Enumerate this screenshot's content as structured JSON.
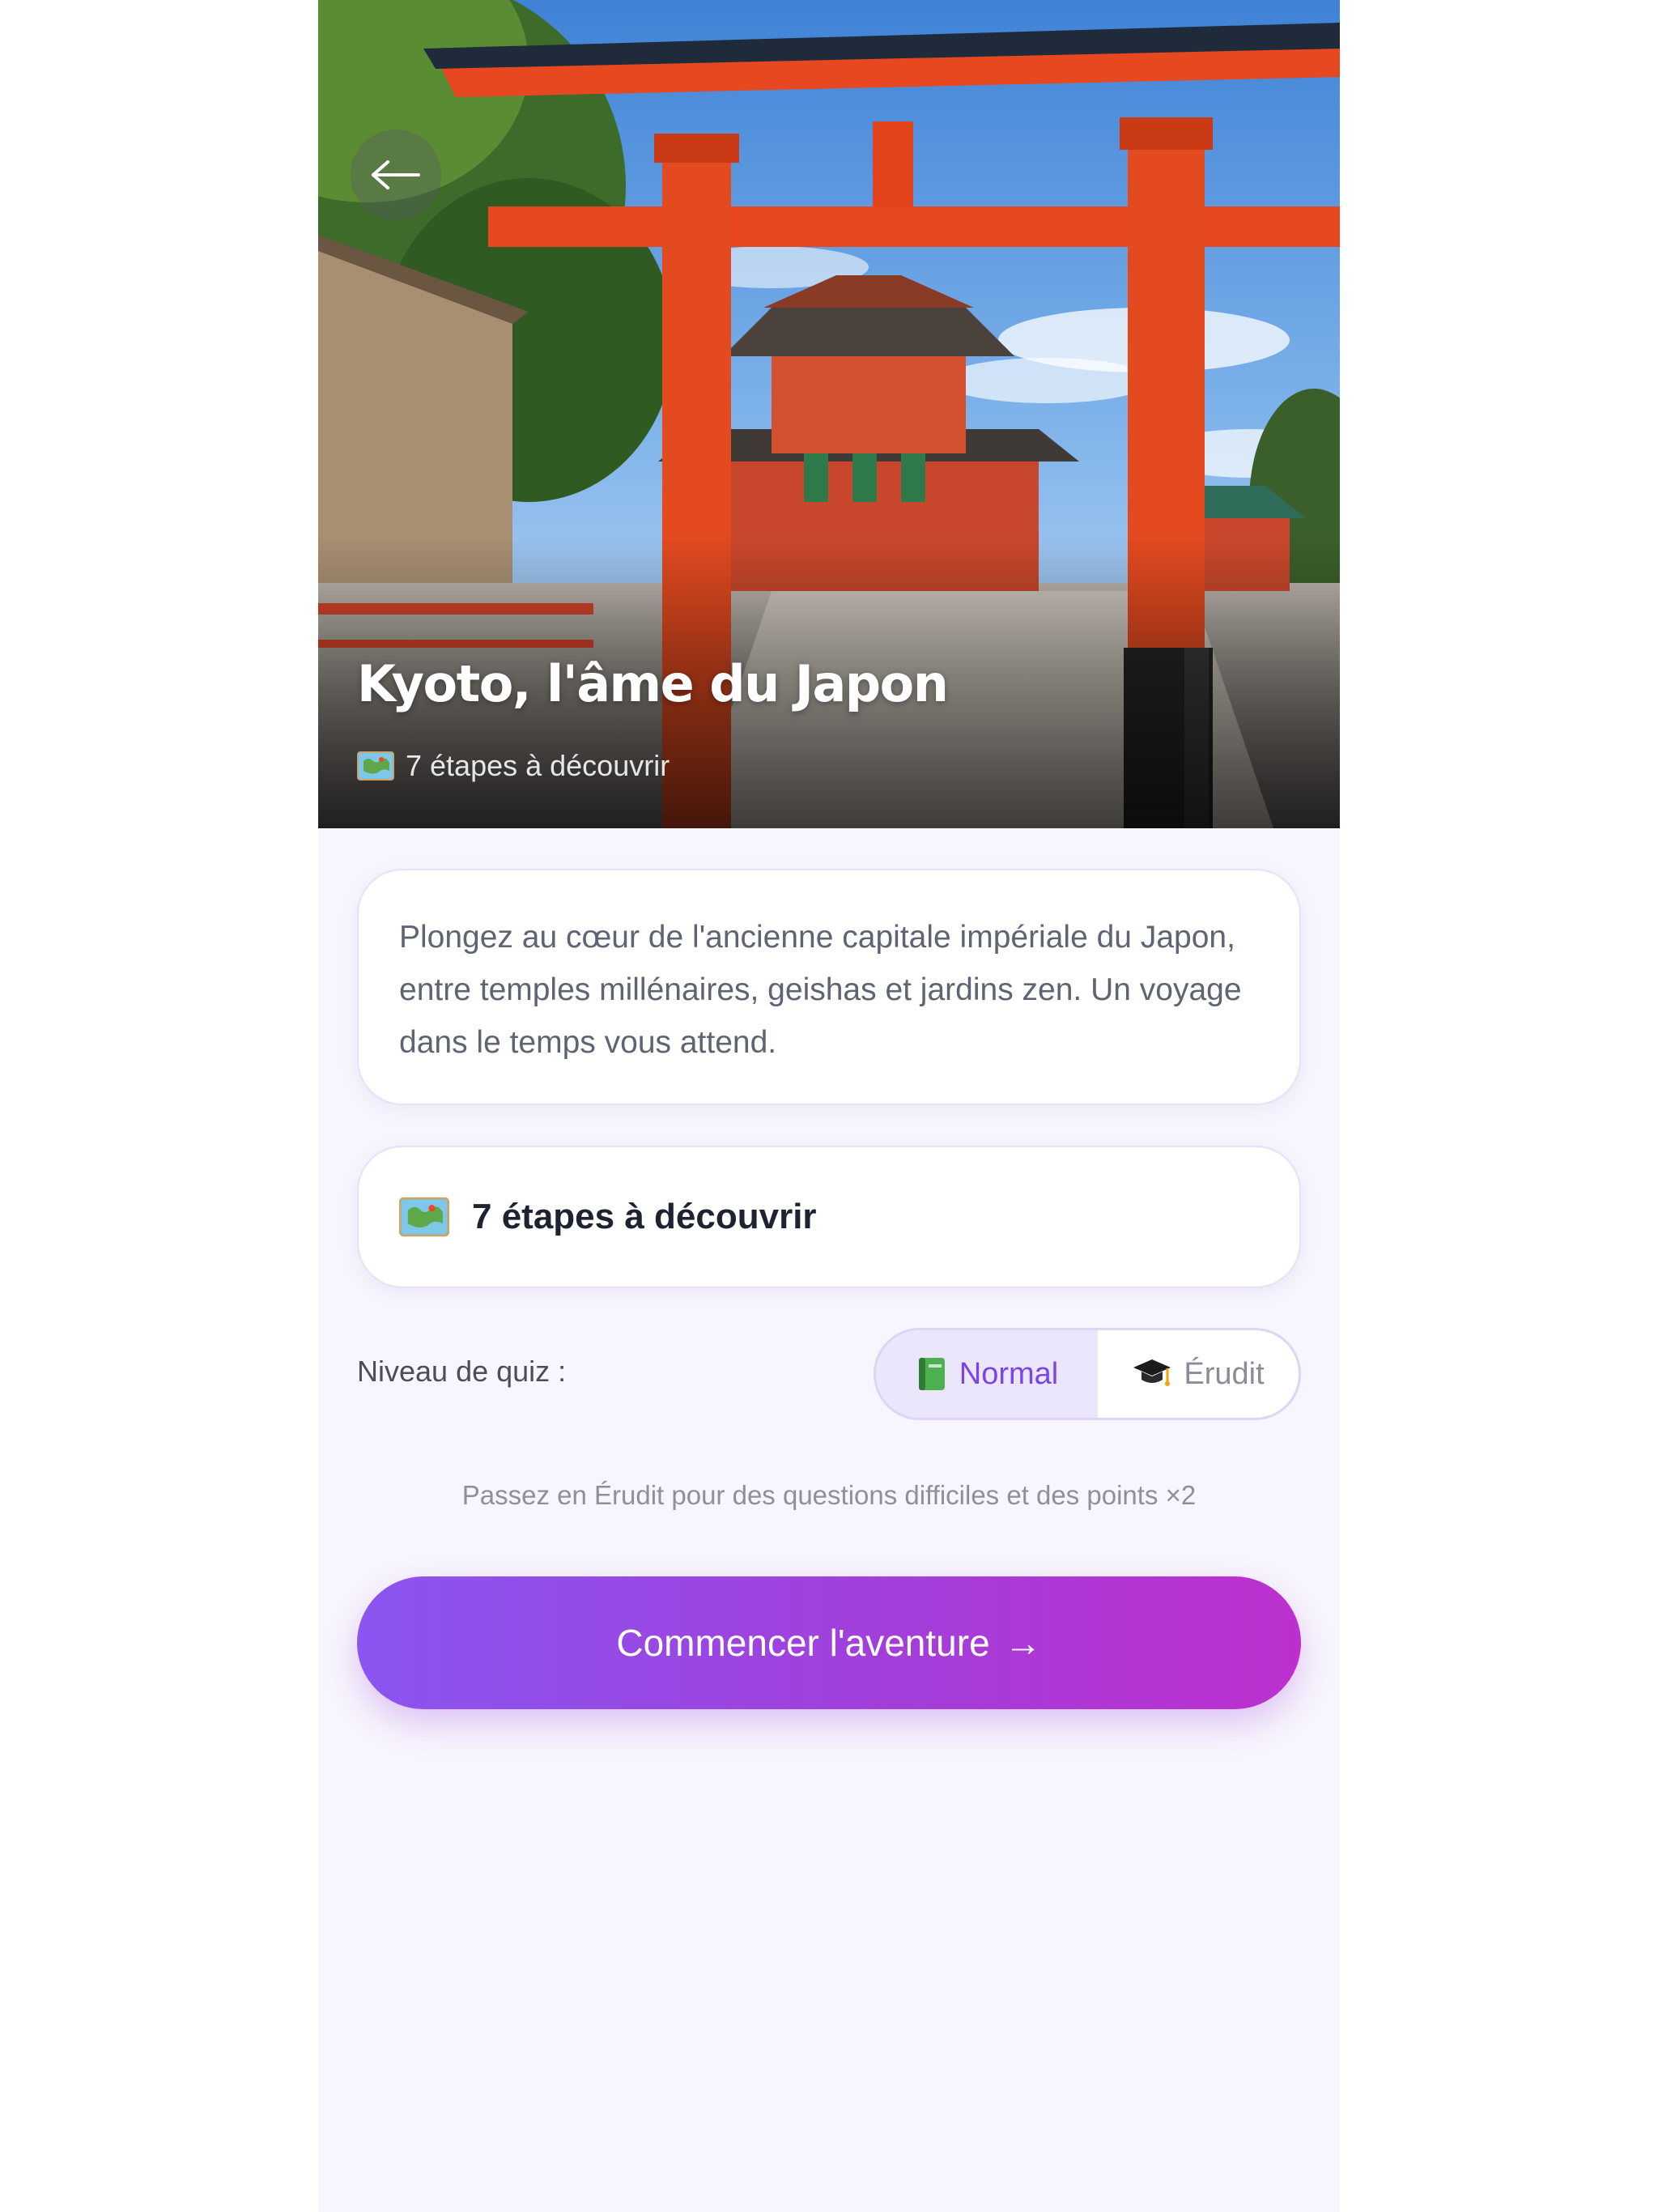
{
  "hero": {
    "title": "Kyoto, l'âme du Japon",
    "subtitle": "7 étapes à découvrir",
    "subtitle_icon": "map-icon",
    "back_icon": "arrow-left-icon"
  },
  "description": "Plongez au cœur de l'ancienne capitale impériale du Japon, entre temples millénaires, geishas et jardins zen. Un voyage dans le temps vous attend.",
  "steps": {
    "icon": "map-icon",
    "label": "7 étapes à découvrir"
  },
  "quiz": {
    "label": "Niveau de quiz :",
    "options": [
      {
        "label": "Normal",
        "icon": "green-book-icon",
        "active": true
      },
      {
        "label": "Érudit",
        "icon": "graduation-cap-icon",
        "active": false
      }
    ],
    "hint": "Passez en Érudit pour des questions difficiles et des points ×2"
  },
  "cta": {
    "label": "Commencer l'aventure",
    "arrow": "→"
  },
  "colors": {
    "accent": "#7a45e8",
    "gradient_start": "#8a55f0",
    "gradient_end": "#bd2fcf",
    "background": "#f7f5fd"
  }
}
